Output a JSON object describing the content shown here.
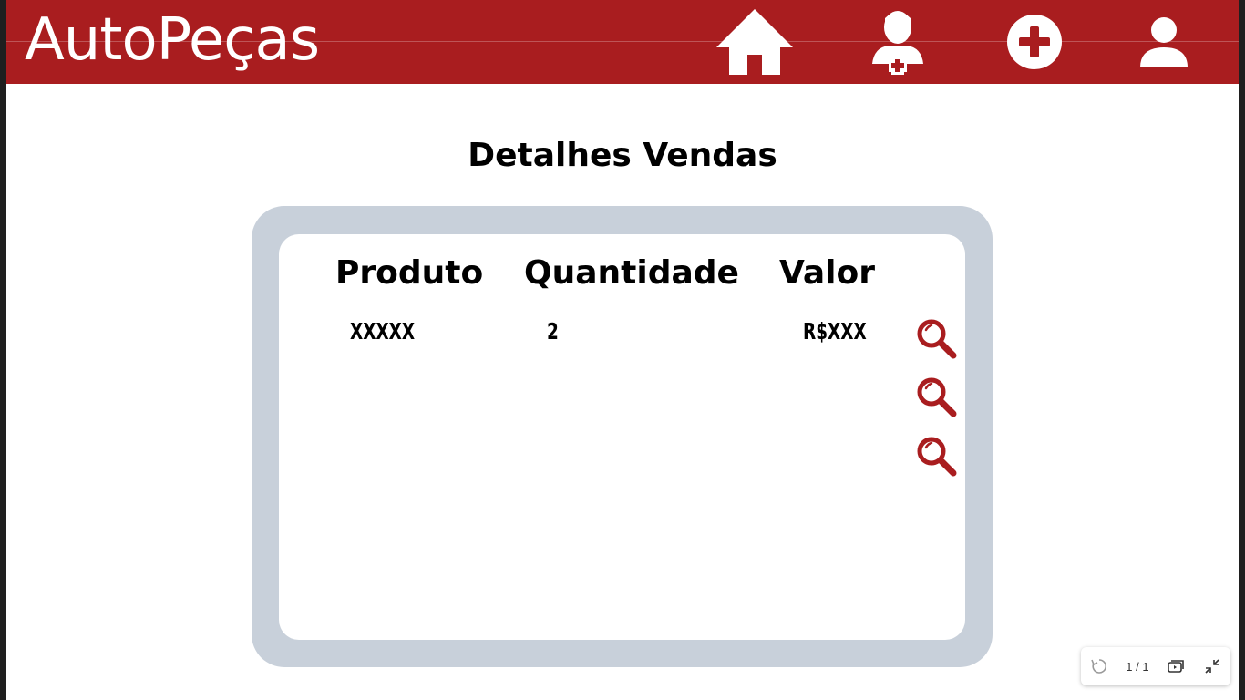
{
  "header": {
    "logo": "AutoPeças",
    "nav": [
      {
        "icon": "home-icon"
      },
      {
        "icon": "add-client-icon"
      },
      {
        "icon": "add-circle-icon"
      },
      {
        "icon": "user-icon"
      }
    ]
  },
  "main": {
    "title": "Detalhes Vendas"
  },
  "table": {
    "columns": [
      "Produto",
      "Quantidade",
      "Valor"
    ],
    "rows": [
      {
        "produto": "XXXXX",
        "quantidade": "2",
        "valor": "R$XXX"
      }
    ],
    "action_icon": "search-icon"
  },
  "viewer": {
    "page_indicator": "1 / 1",
    "icons": [
      "reset-icon",
      "slideshow-icon",
      "exit-fullscreen-icon"
    ]
  },
  "colors": {
    "brand": "#a91d1f",
    "frame": "#c8d0da",
    "search": "#a91d1f"
  }
}
